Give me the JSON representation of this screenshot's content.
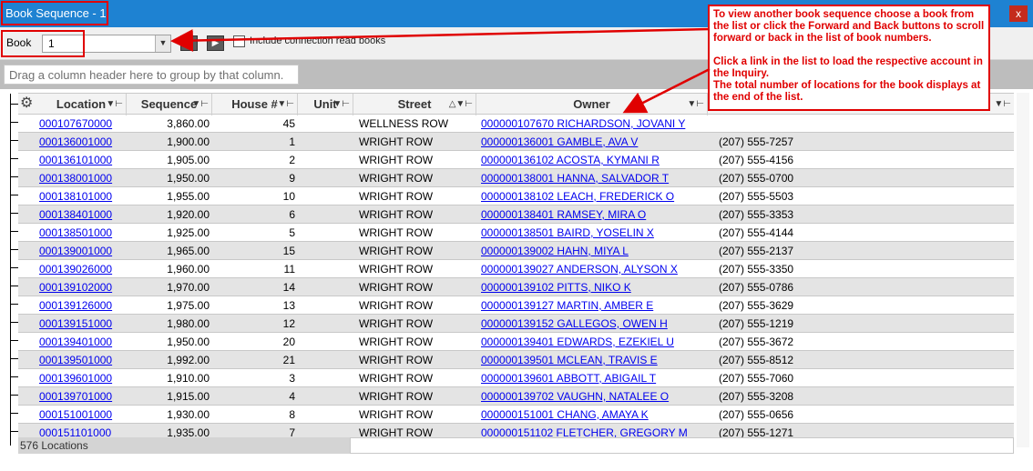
{
  "window": {
    "title": "Book Sequence - 1",
    "close_glyph": "x"
  },
  "toolbar": {
    "book_label": "Book",
    "book_value": "1",
    "back_icon": "back-arrow-icon",
    "forward_icon": "forward-arrow-icon",
    "include_connection_label": "Include connection read books"
  },
  "group_panel": {
    "hint": "Drag a column header here to group by that column."
  },
  "grid": {
    "columns": [
      "Location",
      "Sequence",
      "House #",
      "Unit",
      "Street",
      "Owner"
    ],
    "rows": [
      {
        "location": "000107670000",
        "sequence": "3,860.00",
        "house": "45",
        "street": "WELLNESS ROW",
        "owner": "000000107670 RICHARDSON, JOVANI Y",
        "phone": ""
      },
      {
        "location": "000136001000",
        "sequence": "1,900.00",
        "house": "1",
        "street": "WRIGHT ROW",
        "owner": "000000136001 GAMBLE, AVA V",
        "phone": "(207) 555-7257"
      },
      {
        "location": "000136101000",
        "sequence": "1,905.00",
        "house": "2",
        "street": "WRIGHT ROW",
        "owner": "000000136102 ACOSTA, KYMANI R",
        "phone": "(207) 555-4156"
      },
      {
        "location": "000138001000",
        "sequence": "1,950.00",
        "house": "9",
        "street": "WRIGHT ROW",
        "owner": "000000138001 HANNA, SALVADOR T",
        "phone": "(207) 555-0700"
      },
      {
        "location": "000138101000",
        "sequence": "1,955.00",
        "house": "10",
        "street": "WRIGHT ROW",
        "owner": "000000138102 LEACH, FREDERICK O",
        "phone": "(207) 555-5503"
      },
      {
        "location": "000138401000",
        "sequence": "1,920.00",
        "house": "6",
        "street": "WRIGHT ROW",
        "owner": "000000138401 RAMSEY, MIRA O",
        "phone": "(207) 555-3353"
      },
      {
        "location": "000138501000",
        "sequence": "1,925.00",
        "house": "5",
        "street": "WRIGHT ROW",
        "owner": "000000138501 BAIRD, YOSELIN X",
        "phone": "(207) 555-4144"
      },
      {
        "location": "000139001000",
        "sequence": "1,965.00",
        "house": "15",
        "street": "WRIGHT ROW",
        "owner": "000000139002 HAHN, MIYA L",
        "phone": "(207) 555-2137"
      },
      {
        "location": "000139026000",
        "sequence": "1,960.00",
        "house": "11",
        "street": "WRIGHT ROW",
        "owner": "000000139027 ANDERSON, ALYSON X",
        "phone": "(207) 555-3350"
      },
      {
        "location": "000139102000",
        "sequence": "1,970.00",
        "house": "14",
        "street": "WRIGHT ROW",
        "owner": "000000139102 PITTS, NIKO K",
        "phone": "(207) 555-0786"
      },
      {
        "location": "000139126000",
        "sequence": "1,975.00",
        "house": "13",
        "street": "WRIGHT ROW",
        "owner": "000000139127 MARTIN, AMBER E",
        "phone": "(207) 555-3629"
      },
      {
        "location": "000139151000",
        "sequence": "1,980.00",
        "house": "12",
        "street": "WRIGHT ROW",
        "owner": "000000139152 GALLEGOS, OWEN H",
        "phone": "(207) 555-1219"
      },
      {
        "location": "000139401000",
        "sequence": "1,950.00",
        "house": "20",
        "street": "WRIGHT ROW",
        "owner": "000000139401 EDWARDS, EZEKIEL U",
        "phone": "(207) 555-3672"
      },
      {
        "location": "000139501000",
        "sequence": "1,992.00",
        "house": "21",
        "street": "WRIGHT ROW",
        "owner": "000000139501 MCLEAN, TRAVIS E",
        "phone": "(207) 555-8512"
      },
      {
        "location": "000139601000",
        "sequence": "1,910.00",
        "house": "3",
        "street": "WRIGHT ROW",
        "owner": "000000139601 ABBOTT, ABIGAIL T",
        "phone": "(207) 555-7060"
      },
      {
        "location": "000139701000",
        "sequence": "1,915.00",
        "house": "4",
        "street": "WRIGHT ROW",
        "owner": "000000139702 VAUGHN, NATALEE O",
        "phone": "(207) 555-3208"
      },
      {
        "location": "000151001000",
        "sequence": "1,930.00",
        "house": "8",
        "street": "WRIGHT ROW",
        "owner": "000000151001 CHANG, AMAYA K",
        "phone": "(207) 555-0656"
      },
      {
        "location": "000151101000",
        "sequence": "1,935.00",
        "house": "7",
        "street": "WRIGHT ROW",
        "owner": "000000151102 FLETCHER, GREGORY M",
        "phone": "(207) 555-1271"
      }
    ],
    "footer_count": "576 Locations"
  },
  "callout": {
    "para1": "To view another book sequence choose a book from the list or click the Forward and Back buttons to scroll forward or back in the list of book numbers.",
    "para2": "Click a link in the list to load the respective account in the Inquiry.",
    "para3": "The total number of locations for the book displays at the end of the list."
  },
  "colors": {
    "titlebar": "#1e82d2",
    "annotation": "#e00000",
    "link": "#0000ee",
    "alt_row": "#e4e4e4"
  }
}
